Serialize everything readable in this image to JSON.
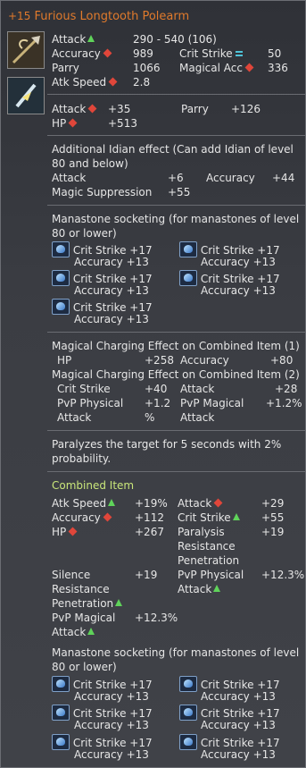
{
  "item": {
    "enhance": "+15",
    "name": "Furious Longtooth Polearm"
  },
  "base_stats": {
    "attack_label": "Attack",
    "attack_value": "290 - 540 (106)",
    "accuracy_label": "Accuracy",
    "accuracy_value": "989",
    "crit_label": "Crit Strike",
    "crit_value": "50",
    "parry_label": "Parry",
    "parry_value": "1066",
    "magacc_label": "Magical Acc",
    "magacc_value": "336",
    "atkspeed_label": "Atk Speed",
    "atkspeed_value": "2.8"
  },
  "bonus": {
    "attack_label": "Attack",
    "attack_value": "+35",
    "parry_label": "Parry",
    "parry_value": "+126",
    "hp_label": "HP",
    "hp_value": "+513"
  },
  "idian": {
    "heading_1": "Additional Idian effect (Can add Idian of level",
    "heading_2": "80 and below)",
    "attack_label": "Attack",
    "attack_value": "+6",
    "accuracy_label": "Accuracy",
    "accuracy_value": "+44",
    "magsup_label": "Magic Suppression",
    "magsup_value": "+55"
  },
  "manastones_1": {
    "heading_1": "Manastone socketing (for manastones of level",
    "heading_2": "80 or lower)",
    "slots": [
      {
        "line1": "Crit Strike +17",
        "line2": "Accuracy +13"
      },
      {
        "line1": "Crit Strike +17",
        "line2": "Accuracy +13"
      },
      {
        "line1": "Crit Strike +17",
        "line2": "Accuracy +13"
      },
      {
        "line1": "Crit Strike +17",
        "line2": "Accuracy +13"
      },
      {
        "line1": "Crit Strike +17",
        "line2": "Accuracy +13"
      }
    ]
  },
  "charging": {
    "heading_1": "Magical Charging Effect on Combined Item (1)",
    "hp_label": "HP",
    "hp_value": "+258",
    "acc_label": "Accuracy",
    "acc_value": "+80",
    "heading_2": "Magical Charging Effect on Combined Item (2)",
    "crit_label": "Crit Strike",
    "crit_value": "+40",
    "attack_label": "Attack",
    "attack_value": "+28",
    "pvp_phys_1": "PvP Physical",
    "pvp_phys_2": "Attack",
    "pvp_phys_value_1": "+1.2",
    "pvp_phys_value_2": "%",
    "pvp_mag_1": "PvP Magical",
    "pvp_mag_2": "Attack",
    "pvp_mag_value": "+1.2%"
  },
  "proc": {
    "line1": "Paralyzes the target for 5 seconds with 2%",
    "line2": "probability."
  },
  "combined": {
    "heading": "Combined Item",
    "atkspeed_label": "Atk Speed",
    "atkspeed_value": "+19%",
    "attack_label": "Attack",
    "attack_value": "+29",
    "accuracy_label": "Accuracy",
    "accuracy_value": "+112",
    "crit_label": "Crit Strike",
    "crit_value": "+55",
    "hp_label": "HP",
    "hp_value": "+267",
    "paralysis_1": "Paralysis",
    "paralysis_2": "Resistance",
    "paralysis_3": "Penetration",
    "paralysis_value": "+19",
    "silence_1": "Silence",
    "silence_2": "Resistance",
    "silence_3": "Penetration",
    "silence_value": "+19",
    "pvpphys_1": "PvP Physical",
    "pvpphys_2": "Attack",
    "pvpphys_value": "+12.3%",
    "pvpmag_1": "PvP Magical",
    "pvpmag_2": "Attack",
    "pvpmag_value": "+12.3%"
  },
  "manastones_2": {
    "heading_1": "Manastone socketing (for manastones of level",
    "heading_2": "80 or lower)",
    "slots": [
      {
        "line1": "Crit Strike +17",
        "line2": "Accuracy +13"
      },
      {
        "line1": "Crit Strike +17",
        "line2": "Accuracy +13"
      },
      {
        "line1": "Crit Strike +17",
        "line2": "Accuracy +13"
      },
      {
        "line1": "Crit Strike +17",
        "line2": "Accuracy +13"
      },
      {
        "line1": "Crit Strike +17",
        "line2": "Accuracy +13"
      },
      {
        "line1": "Crit Strike +17",
        "line2": "Accuracy +13"
      }
    ]
  },
  "icons": {
    "weapon": "polearm-icon",
    "combined": "combined-weapon-icon",
    "up": "arrow-up-icon",
    "down": "diamond-down-icon",
    "same": "equal-icon",
    "stone": "manastone-icon"
  },
  "colors": {
    "title": "#e07a2c",
    "up": "#5fd35a",
    "down": "#e0463a",
    "same": "#4fc3d9",
    "combined_heading": "#c9e67a"
  }
}
